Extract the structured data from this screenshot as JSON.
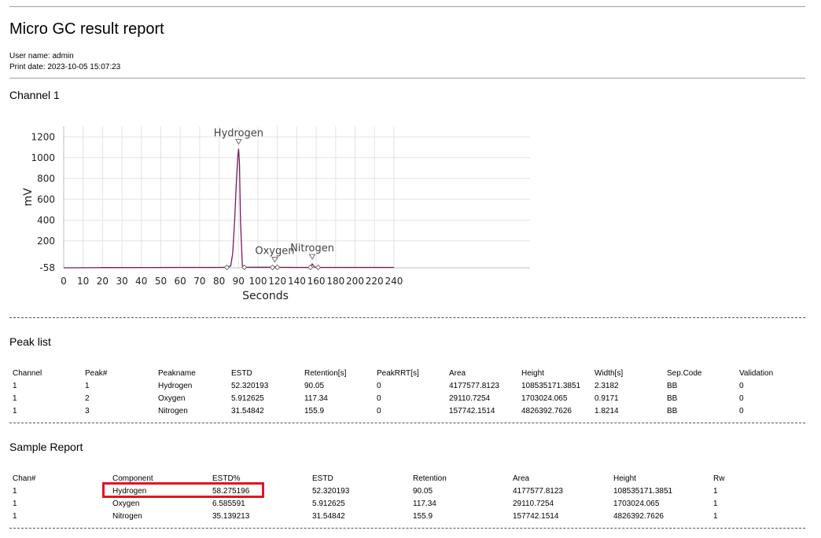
{
  "report": {
    "title": "Micro GC result report",
    "user_line": "User name: admin",
    "print_line": "Print date: 2023-10-05 15:07:23"
  },
  "channel_heading": "Channel 1",
  "chart_data": {
    "type": "line",
    "xlabel": "Seconds",
    "ylabel": "mV",
    "xlim": [
      0,
      240
    ],
    "ylim": [
      -58,
      1300
    ],
    "x_ticks": [
      0,
      10,
      20,
      30,
      40,
      50,
      60,
      70,
      80,
      90,
      100,
      120,
      140,
      160,
      180,
      200,
      220,
      240
    ],
    "y_ticks": [
      -58,
      200,
      400,
      600,
      800,
      1000,
      1200
    ],
    "grid": true,
    "line_color": "#7a1a5a",
    "series": [
      {
        "x": [
          0,
          20,
          40,
          60,
          80,
          84,
          86,
          87,
          88,
          89,
          89.6,
          90.05,
          90.5,
          91,
          92,
          93,
          100,
          115,
          117.34,
          120,
          140,
          154,
          155.9,
          158,
          162,
          180,
          200,
          220,
          240
        ],
        "y": [
          -58,
          -56,
          -55,
          -54,
          -54,
          -53,
          -40,
          80,
          400,
          800,
          1000,
          1085,
          950,
          400,
          -40,
          -52,
          -53,
          -53,
          -48,
          -53,
          -54,
          -54,
          -20,
          -50,
          -54,
          -54,
          -54,
          -54,
          -54
        ]
      }
    ],
    "peaks": [
      {
        "name": "Hydrogen",
        "x": 90.05,
        "y": 1085
      },
      {
        "name": "Oxygen",
        "x": 117.34,
        "y": -48
      },
      {
        "name": "Nitrogen",
        "x": 155.9,
        "y": -20
      }
    ],
    "baseline_markers": [
      84,
      93,
      115,
      120,
      154,
      162
    ]
  },
  "peak_list": {
    "heading": "Peak list",
    "columns": [
      "Channel",
      "Peak#",
      "Peakname",
      "ESTD",
      "Retention[s]",
      "PeakRRT[s]",
      "Area",
      "Height",
      "Width[s]",
      "Sep.Code",
      "Validation"
    ],
    "rows": [
      [
        "1",
        "1",
        "Hydrogen",
        "52.320193",
        "90.05",
        "0",
        "4177577.8123",
        "108535171.3851",
        "2.3182",
        "BB",
        "0"
      ],
      [
        "1",
        "2",
        "Oxygen",
        "5.912625",
        "117.34",
        "0",
        "29110.7254",
        "1703024.065",
        "0.9171",
        "BB",
        "0"
      ],
      [
        "1",
        "3",
        "Nitrogen",
        "31.54842",
        "155.9",
        "0",
        "157742.1514",
        "4826392.7626",
        "1.8214",
        "BB",
        "0"
      ]
    ]
  },
  "sample_report": {
    "heading": "Sample Report",
    "columns": [
      "Chan#",
      "Component",
      "ESTD%",
      "ESTD",
      "Retention",
      "Area",
      "Height",
      "Rw"
    ],
    "rows": [
      [
        "1",
        "Hydrogen",
        "58.275196",
        "52.320193",
        "90.05",
        "4177577.8123",
        "108535171.3851",
        "1"
      ],
      [
        "1",
        "Oxygen",
        "6.585591",
        "5.912625",
        "117.34",
        "29110.7254",
        "1703024.065",
        "1"
      ],
      [
        "1",
        "Nitrogen",
        "35.139213",
        "31.54842",
        "155.9",
        "157742.1514",
        "4826392.7626",
        "1"
      ]
    ],
    "highlight_color": "#e0161e"
  }
}
